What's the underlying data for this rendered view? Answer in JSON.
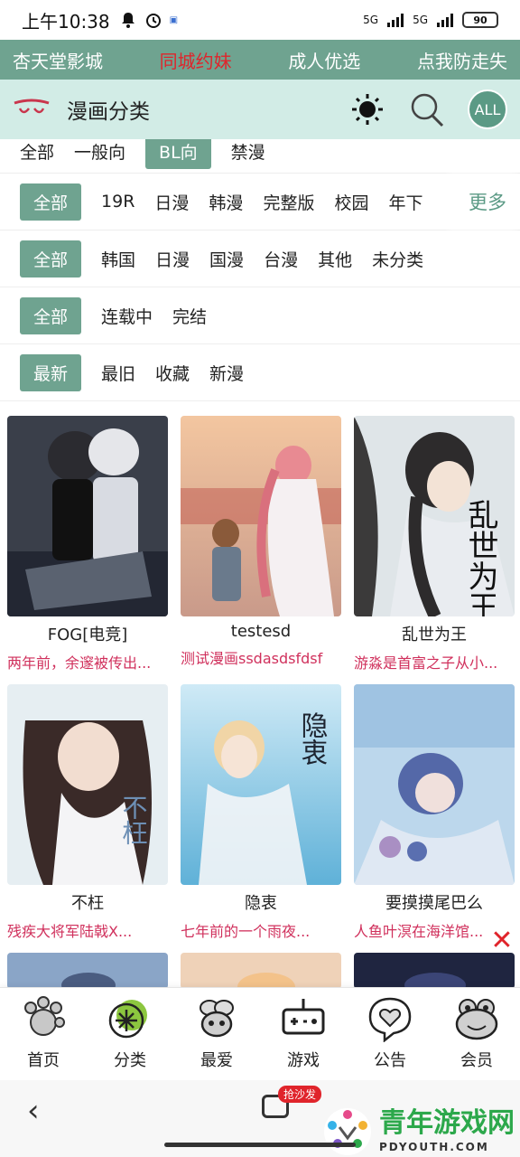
{
  "status": {
    "time": "上午10:38",
    "network_1": "5G",
    "network_2": "5G",
    "battery": "90"
  },
  "promo": [
    "杏天堂影城",
    "同城约妹",
    "成人优选",
    "点我防走失"
  ],
  "header": {
    "title": "漫画分类",
    "all_label": "ALL"
  },
  "filters": {
    "type_row": [
      "全部",
      "一般向",
      "BL向",
      "禁漫"
    ],
    "tag_row": [
      "全部",
      "19R",
      "日漫",
      "韩漫",
      "完整版",
      "校园",
      "年下"
    ],
    "more_label": "更多",
    "region_row": [
      "全部",
      "韩国",
      "日漫",
      "国漫",
      "台漫",
      "其他",
      "未分类"
    ],
    "status_row": [
      "全部",
      "连载中",
      "完结"
    ],
    "sort_row": [
      "最新",
      "最旧",
      "收藏",
      "新漫"
    ]
  },
  "comics": [
    {
      "title": "FOG[电竞]",
      "desc": "两年前，余邃被传出..."
    },
    {
      "title": "testesd",
      "desc": "测试漫画ssdasdsfdsf"
    },
    {
      "title": "乱世为王",
      "desc": "游淼是首富之子从小..."
    },
    {
      "title": "不枉",
      "desc": "残疾大将军陆戟X..."
    },
    {
      "title": "隐衷",
      "desc": "七年前的一个雨夜..."
    },
    {
      "title": "要摸摸尾巴么",
      "desc": "人鱼叶溟在海洋馆..."
    }
  ],
  "cover_text": {
    "c3": "乱世为王",
    "c4": "不枉",
    "c5": "隐衷"
  },
  "tabs": [
    {
      "label": "首页",
      "icon": "frog-hand-icon"
    },
    {
      "label": "分类",
      "icon": "grid-circle-icon"
    },
    {
      "label": "最爱",
      "icon": "bee-icon"
    },
    {
      "label": "游戏",
      "icon": "gamepad-icon"
    },
    {
      "label": "公告",
      "icon": "heart-bubble-icon"
    },
    {
      "label": "会员",
      "icon": "frog-face-icon"
    }
  ],
  "system": {
    "badge": "抢沙发",
    "watermark_big": "青年游戏网",
    "watermark_small": "PDYOUTH.COM"
  },
  "colors": {
    "accent": "#6fa390",
    "header_bg": "#d2ece6",
    "desc": "#d0305c",
    "hot": "#e0242b"
  }
}
